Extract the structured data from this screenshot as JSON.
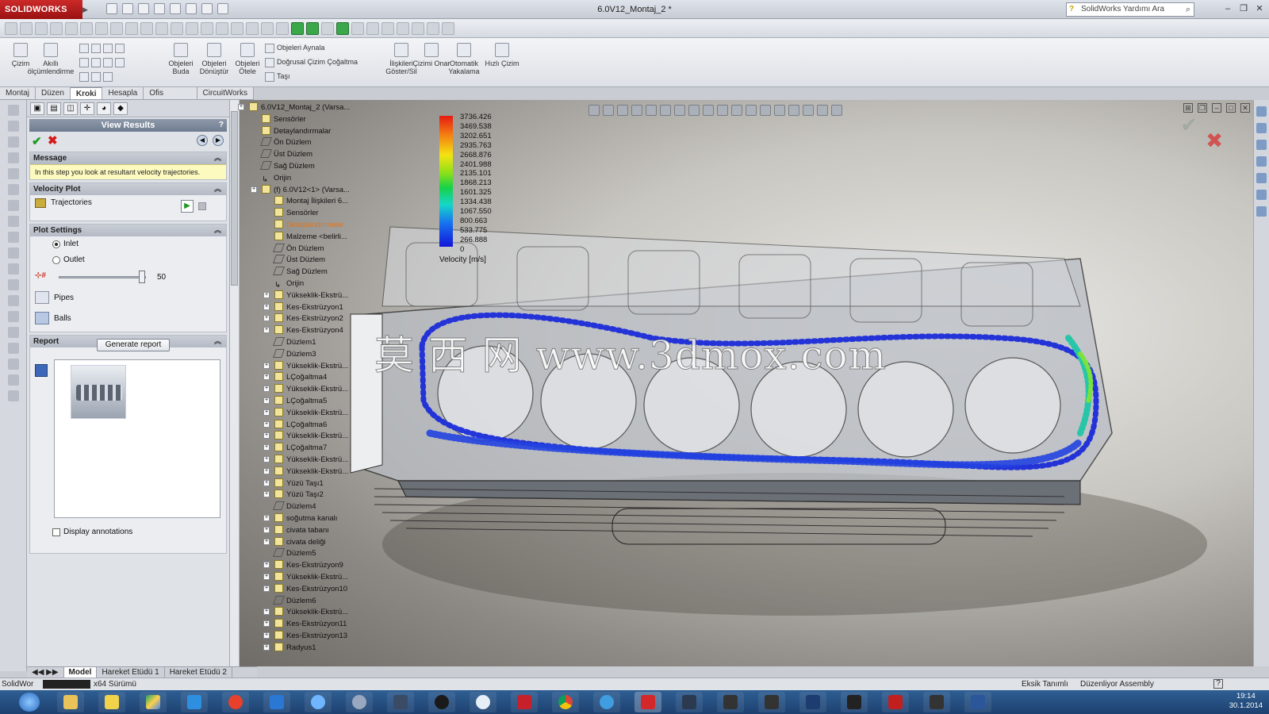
{
  "app": {
    "logo": "SOLIDWORKS",
    "title": "6.0V12_Montaj_2 *"
  },
  "help_search": {
    "placeholder": "SolidWorks Yardımı Ara"
  },
  "ribbon": {
    "cizim": "Çizim",
    "akilli": "Akıllı ölçümlendirme",
    "obj_buda": "Objeleri Buda",
    "obj_donustur": "Objeleri Dönüştür",
    "obj_otele": "Objeleri Ötele",
    "obj_aynala": "Objeleri Aynala",
    "dogrusal": "Doğrusal Çizim Çoğaltma",
    "tasi": "Taşı",
    "iliskileri": "İlişkileri Göster/Sil",
    "cizimi_onar": "Çizimi Onar",
    "otomatik": "Otomatik Yakalama",
    "hizli": "Hızlı Çizim"
  },
  "tabs": [
    {
      "label": "Montaj"
    },
    {
      "label": "Düzen"
    },
    {
      "label": "Kroki"
    },
    {
      "label": "Hesapla"
    },
    {
      "label": "Ofis Ürünleri"
    },
    {
      "label": "CircuitWorks"
    }
  ],
  "pm": {
    "title": "View Results",
    "help": "?",
    "message_head": "Message",
    "message": "In this step you look at resultant velocity trajectories.",
    "velocity_head": "Velocity Plot",
    "trajectories": "Trajectories",
    "plot_head": "Plot Settings",
    "inlet": "Inlet",
    "outlet": "Outlet",
    "slider_value": "50",
    "slider_fraction": 0.95,
    "pipes": "Pipes",
    "balls": "Balls",
    "report_head": "Report",
    "generate": "Generate report",
    "display_ann": "Display annotations"
  },
  "tree": [
    {
      "label": "6.0V12_Montaj_2  (Varsa...",
      "x": 0,
      "type": "asm"
    },
    {
      "label": "Sensörler",
      "x": 16,
      "type": "folder"
    },
    {
      "label": "Detaylandırmalar",
      "x": 16,
      "type": "folder"
    },
    {
      "label": "Ön Düzlem",
      "x": 16,
      "type": "plane"
    },
    {
      "label": "Üst Düzlem",
      "x": 16,
      "type": "plane"
    },
    {
      "label": "Sağ Düzlem",
      "x": 16,
      "type": "plane"
    },
    {
      "label": "Orijin",
      "x": 16,
      "type": "orig"
    },
    {
      "label": "(f) 6.0V12<1> (Varsa...",
      "x": 16,
      "type": "asm"
    },
    {
      "label": "Montaj İlişkileri 6...",
      "x": 32,
      "type": "folder"
    },
    {
      "label": "Sensörler",
      "x": 32,
      "type": "folder"
    },
    {
      "label": "Detaylandırmalar",
      "x": 32,
      "type": "folder",
      "orange": true
    },
    {
      "label": "Malzeme <belirli...",
      "x": 32,
      "type": "folder"
    },
    {
      "label": "Ön Düzlem",
      "x": 32,
      "type": "plane"
    },
    {
      "label": "Üst Düzlem",
      "x": 32,
      "type": "plane"
    },
    {
      "label": "Sağ Düzlem",
      "x": 32,
      "type": "plane"
    },
    {
      "label": "Orijin",
      "x": 32,
      "type": "orig"
    },
    {
      "label": "Yükseklik-Ekstrü...",
      "x": 32,
      "type": "feat"
    },
    {
      "label": "Kes-Ekstrüzyon1",
      "x": 32,
      "type": "feat"
    },
    {
      "label": "Kes-Ekstrüzyon2",
      "x": 32,
      "type": "feat"
    },
    {
      "label": "Kes-Ekstrüzyon4",
      "x": 32,
      "type": "feat"
    },
    {
      "label": "Düzlem1",
      "x": 32,
      "type": "plane"
    },
    {
      "label": "Düzlem3",
      "x": 32,
      "type": "plane"
    },
    {
      "label": "Yükseklik-Ekstrü...",
      "x": 32,
      "type": "feat"
    },
    {
      "label": "LÇoğaltma4",
      "x": 32,
      "type": "feat"
    },
    {
      "label": "Yükseklik-Ekstrü...",
      "x": 32,
      "type": "feat"
    },
    {
      "label": "LÇoğaltma5",
      "x": 32,
      "type": "feat"
    },
    {
      "label": "Yükseklik-Ekstrü...",
      "x": 32,
      "type": "feat"
    },
    {
      "label": "LÇoğaltma6",
      "x": 32,
      "type": "feat"
    },
    {
      "label": "Yükseklik-Ekstrü...",
      "x": 32,
      "type": "feat"
    },
    {
      "label": "LÇoğaltma7",
      "x": 32,
      "type": "feat"
    },
    {
      "label": "Yükseklik-Ekstrü...",
      "x": 32,
      "type": "feat"
    },
    {
      "label": "Yükseklik-Ekstrü...",
      "x": 32,
      "type": "feat"
    },
    {
      "label": "Yüzü Taşı1",
      "x": 32,
      "type": "feat"
    },
    {
      "label": "Yüzü Taşı2",
      "x": 32,
      "type": "feat"
    },
    {
      "label": "Düzlem4",
      "x": 32,
      "type": "plane"
    },
    {
      "label": "soğutma kanalı",
      "x": 32,
      "type": "feat"
    },
    {
      "label": "civata tabanı",
      "x": 32,
      "type": "feat"
    },
    {
      "label": "civata deliği",
      "x": 32,
      "type": "feat"
    },
    {
      "label": "Düzlem5",
      "x": 32,
      "type": "plane"
    },
    {
      "label": "Kes-Ekstrüzyon9",
      "x": 32,
      "type": "feat"
    },
    {
      "label": "Yükseklik-Ekstrü...",
      "x": 32,
      "type": "feat"
    },
    {
      "label": "Kes-Ekstrüzyon10",
      "x": 32,
      "type": "feat"
    },
    {
      "label": "Düzlem6",
      "x": 32,
      "type": "plane"
    },
    {
      "label": "Yükseklik-Ekstrü...",
      "x": 32,
      "type": "feat"
    },
    {
      "label": "Kes-Ekstrüzyon11",
      "x": 32,
      "type": "feat"
    },
    {
      "label": "Kes-Ekstrüzyon13",
      "x": 32,
      "type": "feat"
    },
    {
      "label": "Radyus1",
      "x": 32,
      "type": "feat"
    }
  ],
  "bottom_tabs": [
    "Model",
    "Hareket Etüdü 1",
    "Hareket Etüdü 2"
  ],
  "legend": {
    "title": "Velocity [m/s]",
    "ticks": [
      "3736.426",
      "3469.538",
      "3202.651",
      "2935.763",
      "2668.876",
      "2401.988",
      "2135.101",
      "1868.213",
      "1601.325",
      "1334.438",
      "1067.550",
      "800.663",
      "533.775",
      "266.888",
      "0"
    ]
  },
  "watermark": "莫 西 网 www.3dmox.com",
  "status": {
    "app": "SolidWor",
    "version": "x64 Sürümü",
    "undefined": "Eksik Tanımlı",
    "editing": "Düzenliyor Assembly",
    "help": "?"
  },
  "taskbar": {
    "time": "19:14",
    "date": "30.1.2014"
  },
  "colors": {
    "accent": "#c8201f",
    "message_bg": "#fdfac0",
    "taskbar": "#1d4170"
  }
}
